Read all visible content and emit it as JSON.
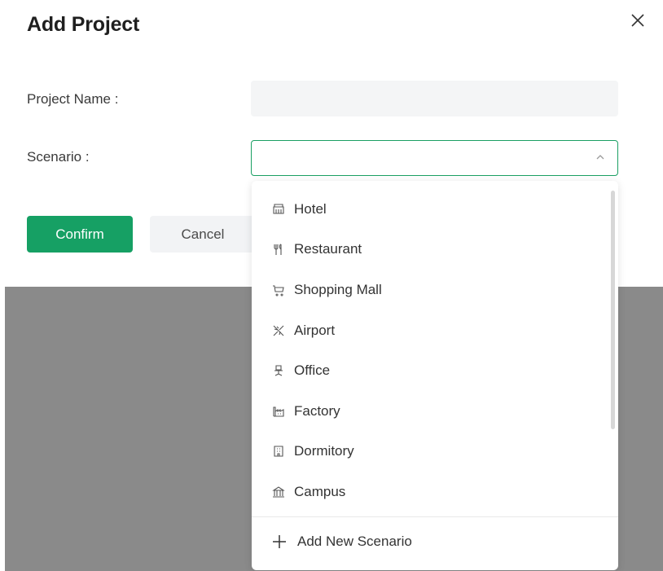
{
  "dialog": {
    "title": "Add Project",
    "close_icon": "close-icon"
  },
  "form": {
    "project_name_label": "Project Name :",
    "project_name_value": "",
    "scenario_label": "Scenario :",
    "scenario_value": ""
  },
  "actions": {
    "confirm_label": "Confirm",
    "cancel_label": "Cancel"
  },
  "scenario_dropdown": {
    "options": [
      {
        "label": "Hotel",
        "icon": "hotel-icon"
      },
      {
        "label": "Restaurant",
        "icon": "fork-knife-icon"
      },
      {
        "label": "Shopping Mall",
        "icon": "shopping-cart-icon"
      },
      {
        "label": "Airport",
        "icon": "airplane-icon"
      },
      {
        "label": "Office",
        "icon": "office-chair-icon"
      },
      {
        "label": "Factory",
        "icon": "factory-icon"
      },
      {
        "label": "Dormitory",
        "icon": "dormitory-building-icon"
      },
      {
        "label": "Campus",
        "icon": "campus-building-icon"
      }
    ],
    "add_new_label": "Add New Scenario",
    "add_new_icon": "plus-icon"
  },
  "colors": {
    "accent": "#16a064",
    "focus_border": "#1a9f63",
    "overlay": "#8a8a8a"
  }
}
